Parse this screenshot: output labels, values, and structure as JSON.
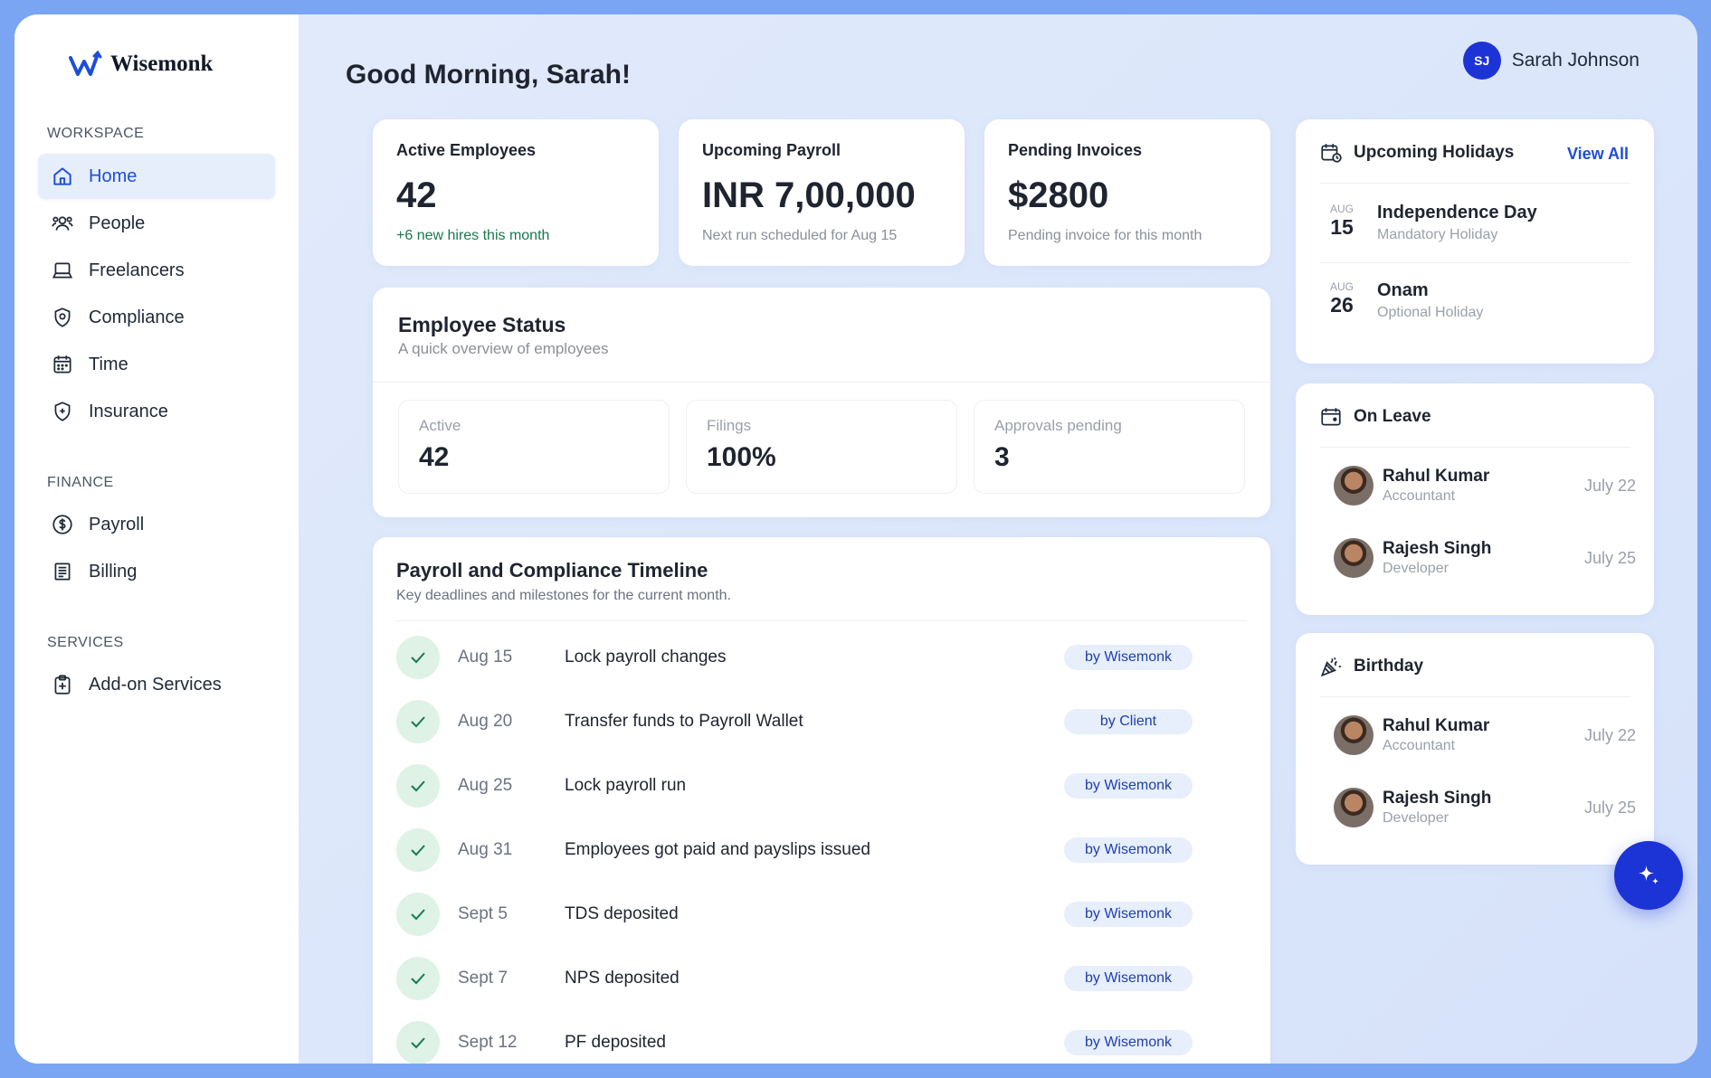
{
  "brand": {
    "name": "Wisemonk"
  },
  "sidebar": {
    "workspace_label": "WORKSPACE",
    "workspace_items": [
      {
        "label": "Home",
        "icon": "home-icon",
        "active": true
      },
      {
        "label": "People",
        "icon": "people-icon"
      },
      {
        "label": "Freelancers",
        "icon": "laptop-icon"
      },
      {
        "label": "Compliance",
        "icon": "shield-icon"
      },
      {
        "label": "Time",
        "icon": "calendar-icon"
      },
      {
        "label": "Insurance",
        "icon": "shield-plus-icon"
      }
    ],
    "finance_label": "FINANCE",
    "finance_items": [
      {
        "label": "Payroll",
        "icon": "dollar-icon"
      },
      {
        "label": "Billing",
        "icon": "receipt-icon"
      }
    ],
    "services_label": "SERVICES",
    "services_items": [
      {
        "label": "Add-on Services",
        "icon": "clipboard-plus-icon"
      }
    ]
  },
  "header": {
    "greeting": "Good Morning, Sarah!",
    "user_initials": "SJ",
    "user_name": "Sarah Johnson"
  },
  "stats": [
    {
      "title": "Active Employees",
      "value": "42",
      "sub": "+6 new hires this month"
    },
    {
      "title": "Upcoming Payroll",
      "value": "INR 7,00,000",
      "sub": "Next run scheduled for Aug 15"
    },
    {
      "title": "Pending Invoices",
      "value": "$2800",
      "sub": "Pending invoice for this month"
    }
  ],
  "employee_status": {
    "title": "Employee Status",
    "subtitle": "A quick overview of employees",
    "metrics": [
      {
        "label": "Active",
        "value": "42"
      },
      {
        "label": "Filings",
        "value": "100%"
      },
      {
        "label": "Approvals pending",
        "value": "3"
      }
    ]
  },
  "timeline": {
    "title": "Payroll and Compliance Timeline",
    "subtitle": "Key deadlines and milestones for the current month.",
    "rows": [
      {
        "date": "Aug 15",
        "text": "Lock payroll changes",
        "owner": "by Wisemonk"
      },
      {
        "date": "Aug 20",
        "text": "Transfer funds to Payroll Wallet",
        "owner": "by Client"
      },
      {
        "date": "Aug 25",
        "text": "Lock payroll run",
        "owner": "by Wisemonk"
      },
      {
        "date": "Aug 31",
        "text": "Employees got paid and payslips issued",
        "owner": "by Wisemonk"
      },
      {
        "date": "Sept 5",
        "text": "TDS deposited",
        "owner": "by Wisemonk"
      },
      {
        "date": "Sept 7",
        "text": "NPS deposited",
        "owner": "by Wisemonk"
      },
      {
        "date": "Sept 12",
        "text": "PF deposited",
        "owner": "by Wisemonk"
      }
    ]
  },
  "holidays": {
    "title": "Upcoming Holidays",
    "view_all": "View All",
    "items": [
      {
        "month": "AUG",
        "day": "15",
        "name": "Independence Day",
        "type": "Mandatory Holiday"
      },
      {
        "month": "AUG",
        "day": "26",
        "name": "Onam",
        "type": "Optional Holiday"
      }
    ]
  },
  "on_leave": {
    "title": "On Leave",
    "people": [
      {
        "name": "Rahul Kumar",
        "role": "Accountant",
        "date": "July 22"
      },
      {
        "name": "Rajesh Singh",
        "role": "Developer",
        "date": "July 25"
      }
    ]
  },
  "birthday": {
    "title": "Birthday",
    "people": [
      {
        "name": "Rahul Kumar",
        "role": "Accountant",
        "date": "July 22"
      },
      {
        "name": "Rajesh Singh",
        "role": "Developer",
        "date": "July 25"
      }
    ]
  },
  "colors": {
    "accent": "#1d4ed8",
    "fab": "#1c33d6",
    "success": "#18794e"
  }
}
